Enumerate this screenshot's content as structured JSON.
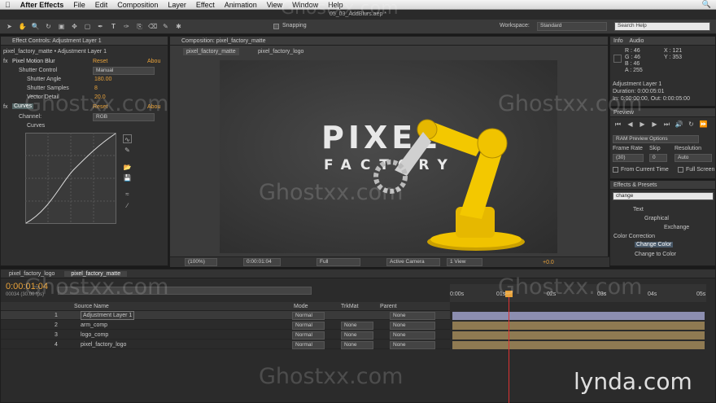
{
  "menu": {
    "app": "After Effects",
    "items": [
      "File",
      "Edit",
      "Composition",
      "Layer",
      "Effect",
      "Animation",
      "View",
      "Window",
      "Help"
    ]
  },
  "project_file": "05_03_AddBlurs.aep *",
  "toolbar": {
    "snapping": "Snapping",
    "workspace_label": "Workspace:",
    "workspace": "Standard",
    "search_placeholder": "Search Help"
  },
  "effect_controls": {
    "tab": "Effect Controls: Adjustment Layer 1",
    "breadcrumb": "pixel_factory_matte • Adjustment Layer 1",
    "pmb": {
      "name": "Pixel Motion Blur",
      "reset": "Reset",
      "about": "Abou",
      "shutter_control_label": "Shutter Control",
      "shutter_control": "Manual",
      "angle_label": "Shutter Angle",
      "angle": "180.00",
      "samples_label": "Shutter Samples",
      "samples": "8",
      "vector_label": "Vector Detail",
      "vector": "20.0"
    },
    "curves": {
      "name": "Curves",
      "reset": "Reset",
      "about": "Abou",
      "channel_label": "Channel:",
      "channel": "RGB",
      "curves_label": "Curves"
    }
  },
  "composition": {
    "tab": "Composition: pixel_factory_matte",
    "subtabs": [
      "pixel_factory_matte",
      "pixel_factory_logo"
    ],
    "logo_top": "PIXEL",
    "logo_bottom": "FACTORY",
    "zoom": "(100%)",
    "timecode": "0:00:01:04",
    "resolution": "Full",
    "camera": "Active Camera",
    "view": "1 View",
    "exposure": "+0.0"
  },
  "info": {
    "tab": "Info",
    "tab2": "Audio",
    "r": "R : 46",
    "g": "G : 46",
    "b": "B : 46",
    "a": "A : 255",
    "x": "X : 121",
    "y": "Y : 353",
    "layer": "Adjustment Layer 1",
    "duration": "Duration: 0:00:05:01",
    "inout": "In: 0:00:00:00, Out: 0:00:05:00"
  },
  "preview": {
    "tab": "Preview",
    "ram": "RAM Preview Options",
    "frame_rate_label": "Frame Rate",
    "skip_label": "Skip",
    "resolution_label": "Resolution",
    "frame_rate": "(30)",
    "skip": "0",
    "resolution": "Auto",
    "from_current": "From Current Time",
    "full_screen": "Full Screen"
  },
  "effects_presets": {
    "tab": "Effects & Presets",
    "search": "change",
    "items": [
      {
        "label": "Text",
        "level": 1
      },
      {
        "label": "Graphical",
        "level": 2
      },
      {
        "label": "Exchange",
        "level": 3
      },
      {
        "label": "Color Correction",
        "level": 0
      },
      {
        "label": "Change Color",
        "level": 1,
        "selected": true
      },
      {
        "label": "Change to Color",
        "level": 1
      }
    ]
  },
  "timeline": {
    "tabs": [
      "pixel_factory_logo",
      "pixel_factory_matte"
    ],
    "timecode": "0:00:01:04",
    "frames": "00034 (30.00 fps)",
    "headers": {
      "source": "Source Name",
      "mode": "Mode",
      "trkmat": "TrkMat",
      "parent": "Parent"
    },
    "ruler": [
      "0:00s",
      "01s",
      "02s",
      "03s",
      "04s",
      "05s"
    ],
    "layers": [
      {
        "num": "1",
        "name": "Adjustment Layer 1",
        "mode": "Normal",
        "trkmat": "",
        "parent": "None"
      },
      {
        "num": "2",
        "name": "arm_comp",
        "mode": "Normal",
        "trkmat": "None",
        "parent": "None"
      },
      {
        "num": "3",
        "name": "logo_comp",
        "mode": "Normal",
        "trkmat": "None",
        "parent": "None"
      },
      {
        "num": "4",
        "name": "pixel_factory_logo",
        "mode": "Normal",
        "trkmat": "None",
        "parent": "None"
      }
    ]
  },
  "watermarks": [
    "Ghostxx.com",
    "Ghostxx.com",
    "Ghostxx.com",
    "Ghostxx.com",
    "Ghostxx.com",
    "Ghostxx.com",
    "Ghostxx.com",
    "Ghostxx.com"
  ],
  "brand": "lynda.com",
  "colors": {
    "accent": "#e8a23a",
    "bg": "#2f2f2f",
    "robot": "#f0c300"
  }
}
